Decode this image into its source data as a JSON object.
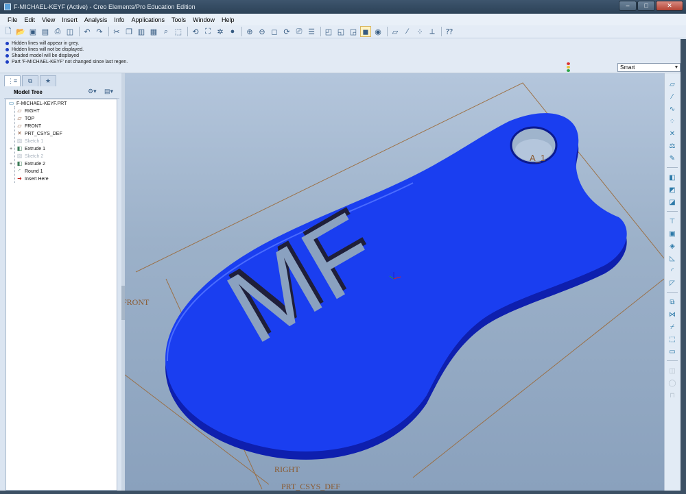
{
  "window": {
    "title": "F-MICHAEL-KEYF (Active) - Creo Elements/Pro Education Edition",
    "controls": {
      "minimize": "–",
      "maximize": "□",
      "close": "✕"
    }
  },
  "menu": [
    "File",
    "Edit",
    "View",
    "Insert",
    "Analysis",
    "Info",
    "Applications",
    "Tools",
    "Window",
    "Help"
  ],
  "toolbar": {
    "icons": [
      "new-icon",
      "open-icon",
      "save-icon",
      "save-copy-icon",
      "print-icon",
      "print-preview-icon",
      "undo-icon",
      "redo-icon",
      "cut-icon",
      "copy-icon",
      "paste-icon",
      "paste-special-icon",
      "find-icon",
      "select-box-icon",
      "regenerate-icon",
      "regenerate-manager-icon",
      "spin-center-icon",
      "display-style-icon",
      "zoom-in-icon",
      "zoom-out-icon",
      "refit-icon",
      "reorient-icon",
      "saved-views-icon",
      "layers-icon",
      "wireframe-icon",
      "hidden-line-icon",
      "no-hidden-icon",
      "shading-icon",
      "enhanced-realism-icon",
      "plane-display-icon",
      "axis-display-icon",
      "point-display-icon",
      "csys-display-icon",
      "context-help-icon"
    ]
  },
  "messages": [
    "Hidden lines will appear in grey.",
    "Hidden lines will not be displayed.",
    "Shaded model will be displayed",
    "Part 'F-MICHAEL-KEYF' not changed since last regen."
  ],
  "filter": {
    "selected": "Smart"
  },
  "model_tree": {
    "title": "Model Tree",
    "items": [
      {
        "label": "F-MICHAEL-KEYF.PRT",
        "icon": "part-icon",
        "dim": false,
        "expandable": false
      },
      {
        "label": "RIGHT",
        "icon": "datum-plane-icon",
        "dim": false,
        "expandable": false
      },
      {
        "label": "TOP",
        "icon": "datum-plane-icon",
        "dim": false,
        "expandable": false
      },
      {
        "label": "FRONT",
        "icon": "datum-plane-icon",
        "dim": false,
        "expandable": false
      },
      {
        "label": "PRT_CSYS_DEF",
        "icon": "csys-icon",
        "dim": false,
        "expandable": false
      },
      {
        "label": "Sketch 1",
        "icon": "sketch-icon",
        "dim": true,
        "expandable": false
      },
      {
        "label": "Extrude 1",
        "icon": "extrude-icon",
        "dim": false,
        "expandable": true
      },
      {
        "label": "Sketch 2",
        "icon": "sketch-icon",
        "dim": true,
        "expandable": false
      },
      {
        "label": "Extrude 2",
        "icon": "extrude-icon",
        "dim": false,
        "expandable": true
      },
      {
        "label": "Round 1",
        "icon": "round-icon",
        "dim": false,
        "expandable": false
      },
      {
        "label": "Insert Here",
        "icon": "insert-arrow-icon",
        "dim": false,
        "expandable": false
      }
    ]
  },
  "graphics": {
    "datum_labels": {
      "axis": "A_1",
      "front": "FRONT",
      "right": "RIGHT",
      "csys": "PRT_CSYS_DEF"
    },
    "engraved_text": "MF",
    "colors": {
      "part": "#1a3ef0",
      "part_dark": "#0f1fa8",
      "datum": "#9b6a3a",
      "background_top": "#b4c6dc",
      "background_bottom": "#8aa1bd"
    }
  },
  "right_toolbar": {
    "icons": [
      "datum-plane-tool-icon",
      "datum-axis-tool-icon",
      "curve-tool-icon",
      "datum-point-tool-icon",
      "csys-tool-icon",
      "analysis-tool-icon",
      "sketch-tool-icon",
      "extrude-tool-icon",
      "revolve-tool-icon",
      "variable-sweep-icon",
      "hole-tool-icon",
      "shell-tool-icon",
      "rib-tool-icon",
      "draft-tool-icon",
      "round-tool-icon",
      "chamfer-tool-icon",
      "mirror-tool-icon",
      "merge-tool-icon",
      "trim-tool-icon",
      "pattern-tool-icon",
      "offset-tool-icon",
      "thicken-tool-icon",
      "solidify-tool-icon",
      "intersect-tool-icon"
    ]
  }
}
